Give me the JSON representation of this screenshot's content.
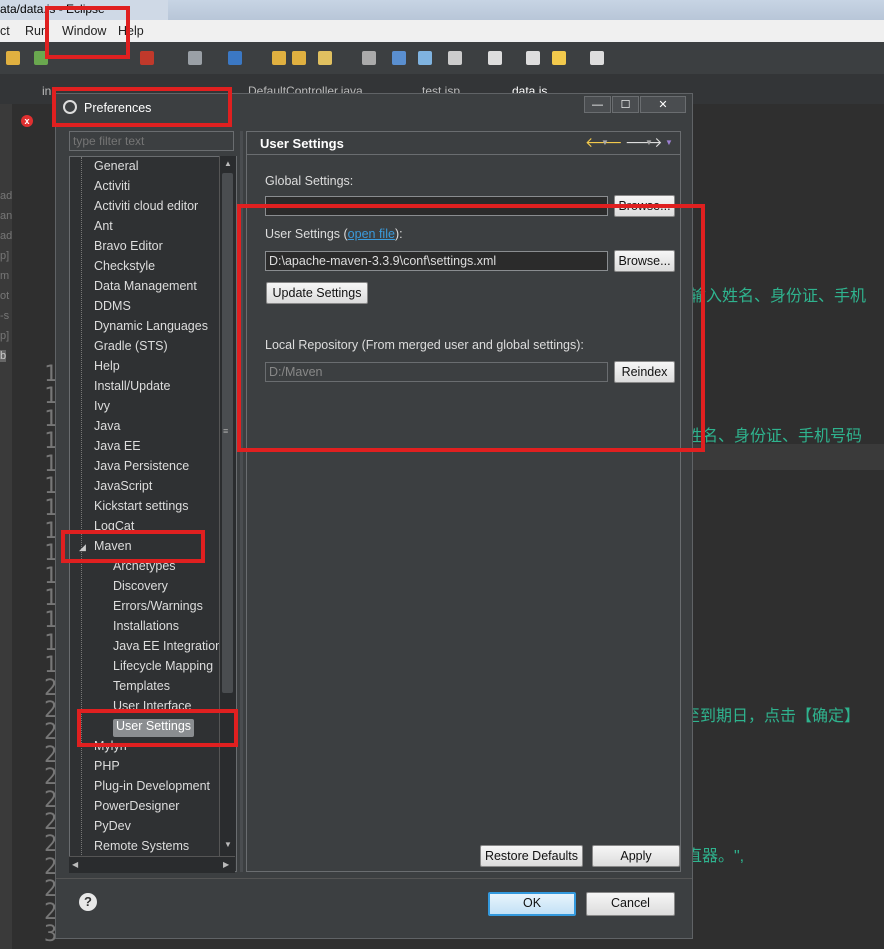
{
  "window": {
    "title": "ata/data.js - Eclipse"
  },
  "menubar": {
    "items": [
      "ct",
      "Run",
      "Window",
      "Help"
    ]
  },
  "editor": {
    "tabs": [
      "in",
      "DefaultController.java",
      "test.jsp",
      "data.js"
    ],
    "line_numbers": [
      "1",
      "1",
      "1",
      "1",
      "1",
      "1",
      "1",
      "1",
      "1",
      "1",
      "1",
      "1",
      "1",
      "1",
      "2",
      "2",
      "2",
      "2",
      "2",
      "2",
      "2",
      "2",
      "2",
      "2",
      "2",
      "3"
    ],
    "left_fragments": [
      "ad",
      "an",
      "ad",
      "p]",
      "m",
      "ot",
      "-s",
      "p]",
      "b"
    ],
    "code_fragments": [
      "输入姓名、身份证、手机",
      "姓名、身份证、手机号码",
      "至到期日，点击【确定】",
      "直器。\","
    ]
  },
  "dialog": {
    "title": "Preferences",
    "filter_placeholder": "type filter text",
    "tree": {
      "items": [
        "General",
        "Activiti",
        "Activiti cloud editor",
        "Ant",
        "Bravo Editor",
        "Checkstyle",
        "Data Management",
        "DDMS",
        "Dynamic Languages",
        "Gradle (STS)",
        "Help",
        "Install/Update",
        "Ivy",
        "Java",
        "Java EE",
        "Java Persistence",
        "JavaScript",
        "Kickstart settings",
        "LogCat",
        "Maven"
      ],
      "maven_children": [
        "Archetypes",
        "Discovery",
        "Errors/Warnings",
        "Installations",
        "Java EE Integration",
        "Lifecycle Mapping",
        "Templates",
        "User Interface",
        "User Settings"
      ],
      "after_items": [
        "Mylyn",
        "PHP",
        "Plug-in Development",
        "PowerDesigner",
        "PyDev",
        "Remote Systems"
      ],
      "selected": "User Settings"
    },
    "page": {
      "title": "User Settings",
      "global_settings_label": "Global Settings:",
      "global_settings_value": "",
      "browse_label": "Browse...",
      "user_settings_label": "User Settings (",
      "open_file_link": "open file",
      "user_settings_label_end": "):",
      "user_settings_value": "D:\\apache-maven-3.3.9\\conf\\settings.xml",
      "update_settings_label": "Update Settings",
      "local_repo_label": "Local Repository (From merged user and global settings):",
      "local_repo_value": "D:/Maven",
      "reindex_label": "Reindex",
      "restore_defaults_label": "Restore Defaults",
      "apply_label": "Apply"
    },
    "buttons": {
      "ok_label": "OK",
      "cancel_label": "Cancel",
      "help_label": "?",
      "minimize": "—",
      "maximize": "☐",
      "close": "✕"
    }
  },
  "colors": {
    "annotation_red": "#e02020",
    "dialog_bg": "#3c3f41",
    "link_blue": "#3b9bdc",
    "code_green": "#2fb38e"
  }
}
